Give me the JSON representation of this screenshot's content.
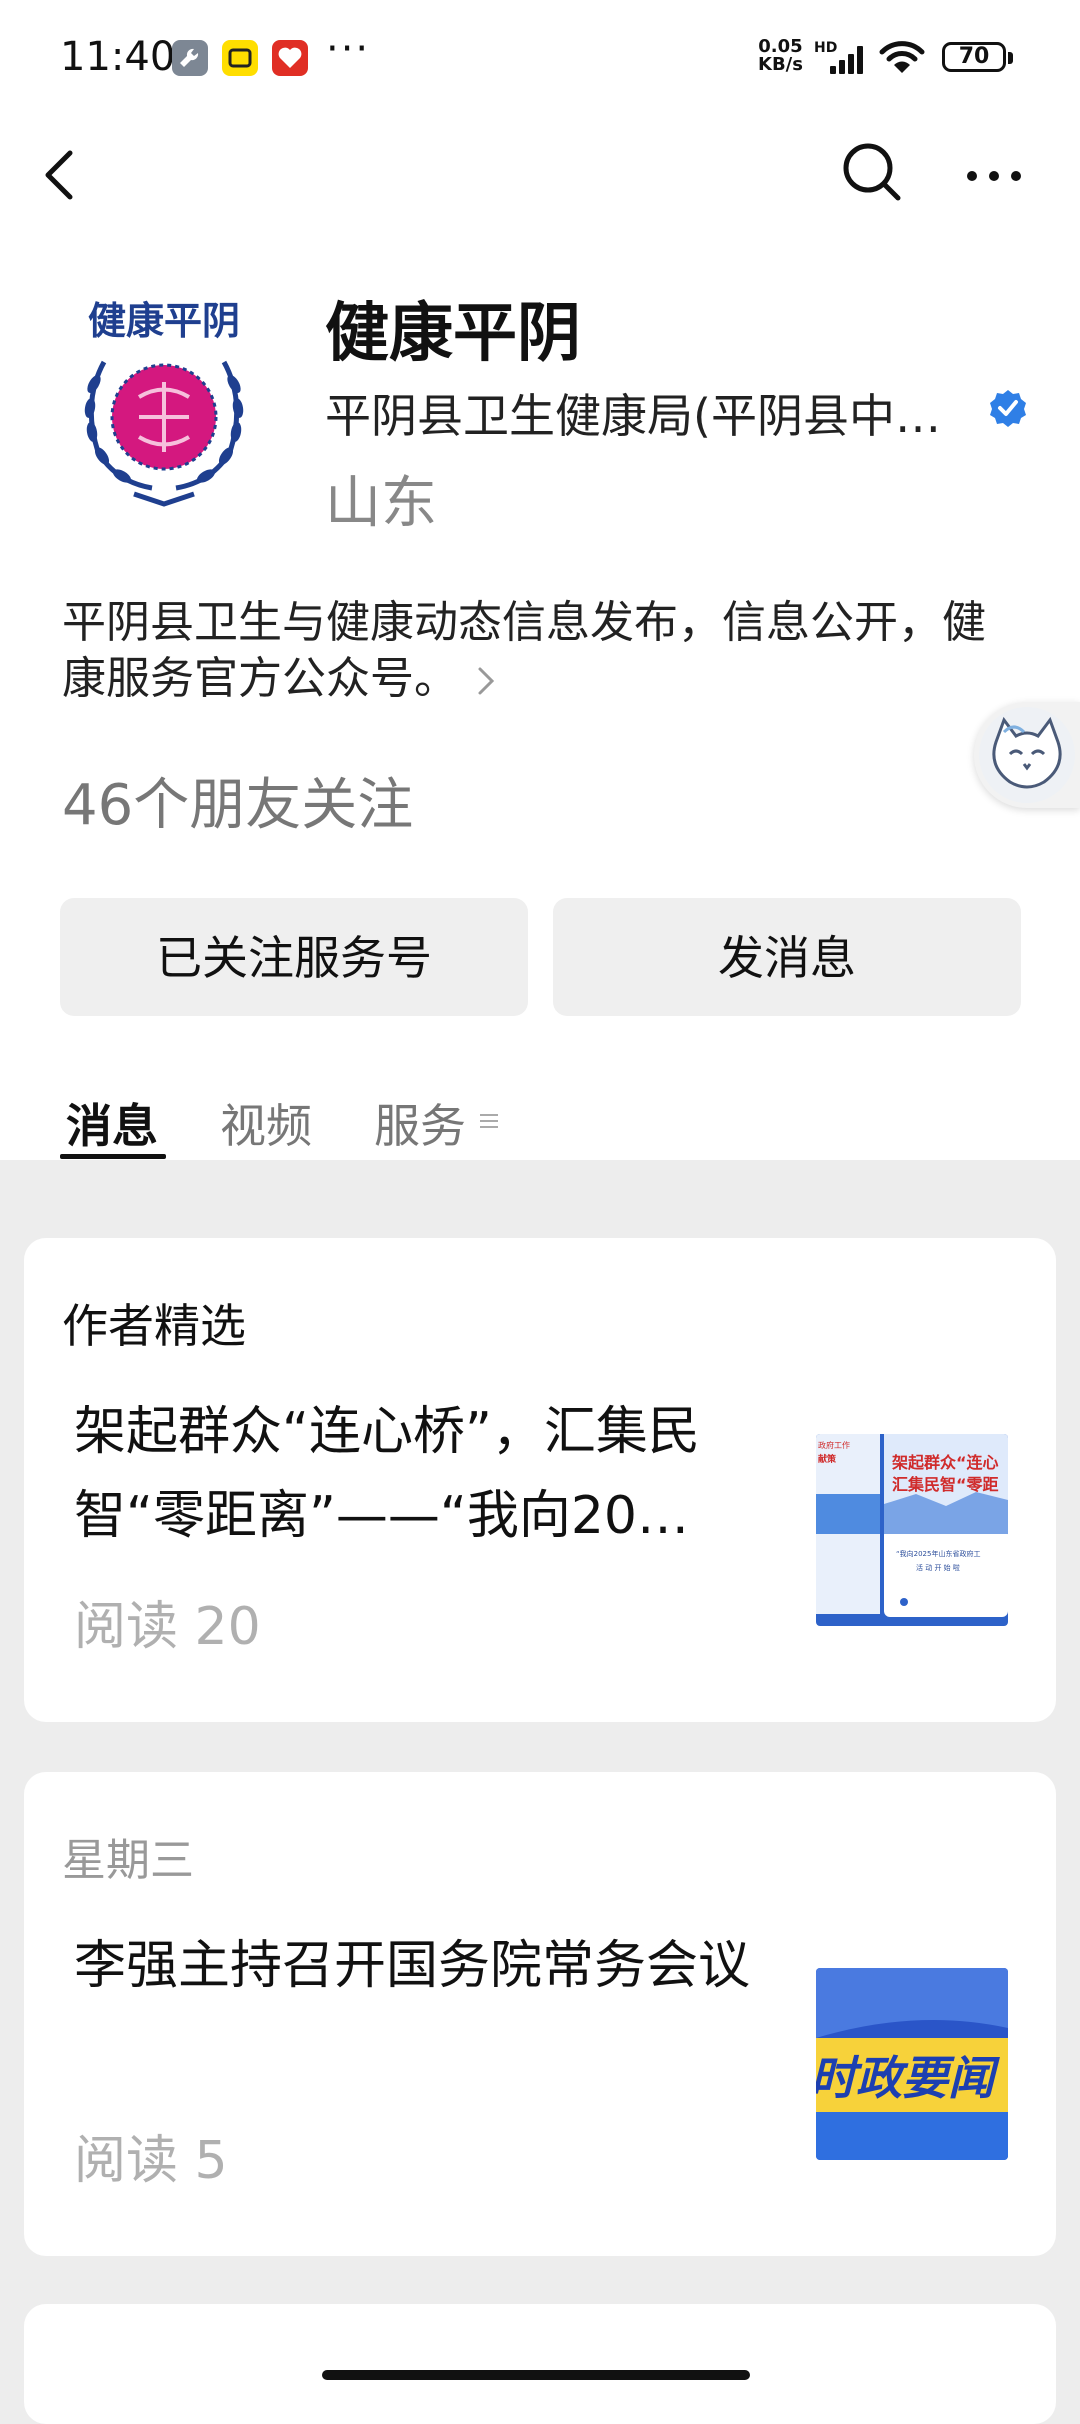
{
  "status_bar": {
    "time": "11:40",
    "more": "···",
    "speed_value": "0.05",
    "speed_unit": "KB/s",
    "network": "HD",
    "battery": "70",
    "app_icons": [
      "wrench-app-icon",
      "xianyu-app-icon",
      "pinduoduo-app-icon"
    ]
  },
  "nav": {
    "back_icon": "chevron-left-icon",
    "search_icon": "search-icon",
    "more_icon": "more-dots-icon"
  },
  "profile": {
    "logo_text": "健康平阴",
    "name": "健康平阴",
    "org": "平阴县卫生健康局(平阴县中…",
    "region": "山东",
    "description": "平阴县卫生与健康动态信息发布，信息公开，健康服务官方公众号。",
    "followers": "46个朋友关注"
  },
  "actions": {
    "followed_label": "已关注服务号",
    "message_label": "发消息"
  },
  "tabs": [
    {
      "label": "消息",
      "active": true
    },
    {
      "label": "视频",
      "active": false
    },
    {
      "label": "服务",
      "active": false
    }
  ],
  "cards": [
    {
      "heading": "作者精选",
      "title": "架起群众“连心桥”，汇集民智“零距离”——“我向20…",
      "read": "阅读 20",
      "thumb_text_1": "架起群众“连心",
      "thumb_text_2": "汇集民智“零距",
      "thumb_text_3": "“我向2025年山东省政府工",
      "thumb_text_4": "活 动 开 始 啦",
      "thumb_text_5": "政府工作",
      "thumb_text_6": "献策"
    },
    {
      "heading": "星期三",
      "title": "李强主持召开国务院常务会议",
      "read": "阅读 5",
      "thumb_text": "时政要闻"
    }
  ]
}
